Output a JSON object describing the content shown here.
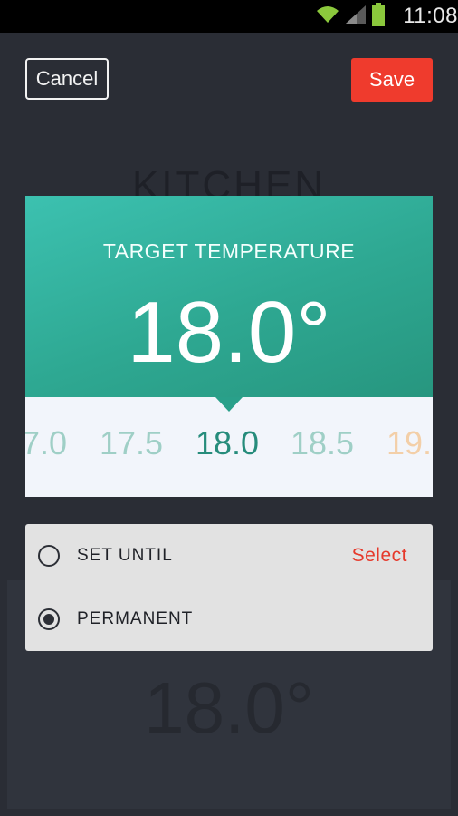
{
  "status_bar": {
    "time": "11:08",
    "icons": [
      "wifi-icon",
      "signal-icon",
      "battery-icon"
    ],
    "battery_color": "#8bc83c"
  },
  "background": {
    "room_name": "KITCHEN",
    "temperature": "18.0°"
  },
  "header": {
    "cancel_label": "Cancel",
    "save_label": "Save"
  },
  "target": {
    "title": "TARGET TEMPERATURE",
    "value": "18.0°"
  },
  "picker": {
    "values": [
      "7.0",
      "17.5",
      "18.0",
      "18.5",
      "19."
    ],
    "selected": "18.0"
  },
  "options": {
    "set_until_label": "SET UNTIL",
    "select_label": "Select",
    "permanent_label": "PERMANENT",
    "selected_option": "PERMANENT"
  },
  "colors": {
    "accent_red": "#ef3b2d",
    "teal": "#2ea892",
    "background": "#2b2e36"
  }
}
